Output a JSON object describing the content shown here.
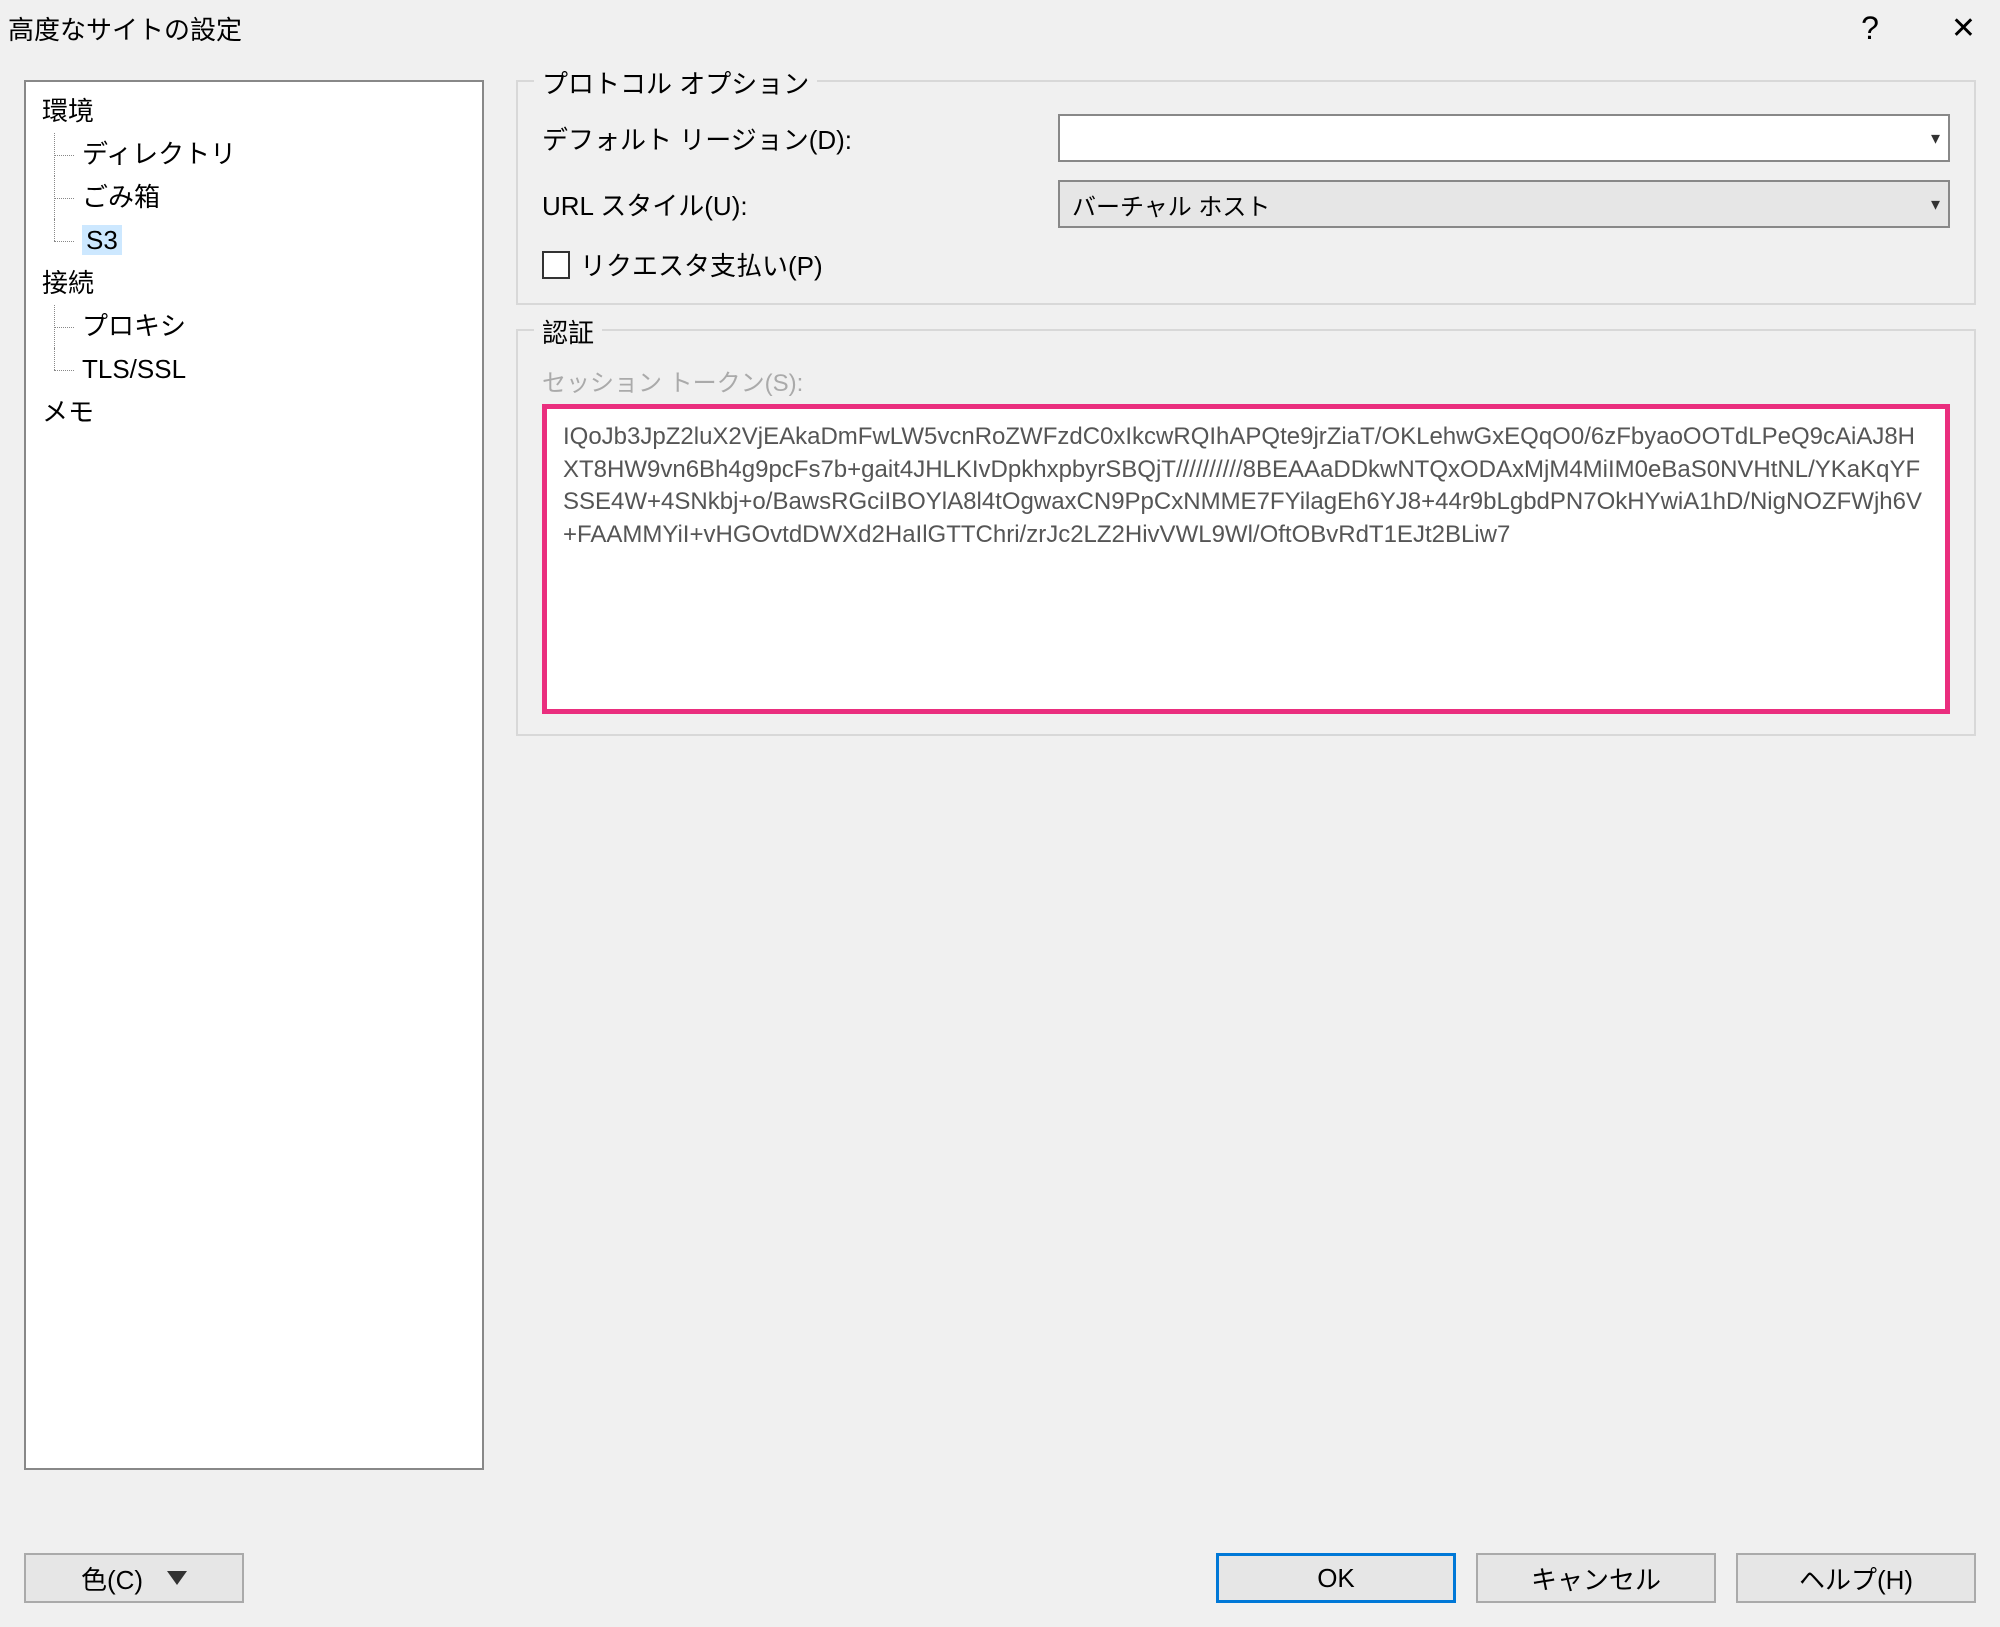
{
  "titlebar": {
    "title": "高度なサイトの設定",
    "help_tooltip": "?",
    "close_tooltip": "✕"
  },
  "tree": {
    "env": "環境",
    "directory": "ディレクトリ",
    "trash": "ごみ箱",
    "s3": "S3",
    "connection": "接続",
    "proxy": "プロキシ",
    "tlsssl": "TLS/SSL",
    "memo": "メモ"
  },
  "protocol": {
    "group_title": "プロトコル オプション",
    "default_region_label": "デフォルト リージョン(D):",
    "default_region_value": "",
    "url_style_label": "URL スタイル(U):",
    "url_style_value": "バーチャル ホスト",
    "requester_pays_label": "リクエスタ支払い(P)"
  },
  "auth": {
    "group_title": "認証",
    "session_token_label": "セッション トークン(S):",
    "session_token_value": "IQoJb3JpZ2luX2VjEAkaDmFwLW5vcnRoZWFzdC0xIkcwRQIhAPQte9jrZiaT/OKLehwGxEQqO0/6zFbyaoOOTdLPeQ9cAiAJ8HXT8HW9vn6Bh4g9pcFs7b+gait4JHLKIvDpkhxpbyrSBQjT//////////8BEAAaDDkwNTQxODAxMjM4MiIM0eBaS0NVHtNL/YKaKqYFSSE4W+4SNkbj+o/BawsRGciIBOYlA8l4tOgwaxCN9PpCxNMME7FYilagEh6YJ8+44r9bLgbdPN7OkHYwiA1hD/NigNOZFWjh6V+FAAMMYiI+vHGOvtdDWXd2HaIlGTTChri/zrJc2LZ2HivVWL9Wl/OftOBvRdT1EJt2BLiw7"
  },
  "footer": {
    "color": "色(C)",
    "ok": "OK",
    "cancel": "キャンセル",
    "help": "ヘルプ(H)"
  }
}
